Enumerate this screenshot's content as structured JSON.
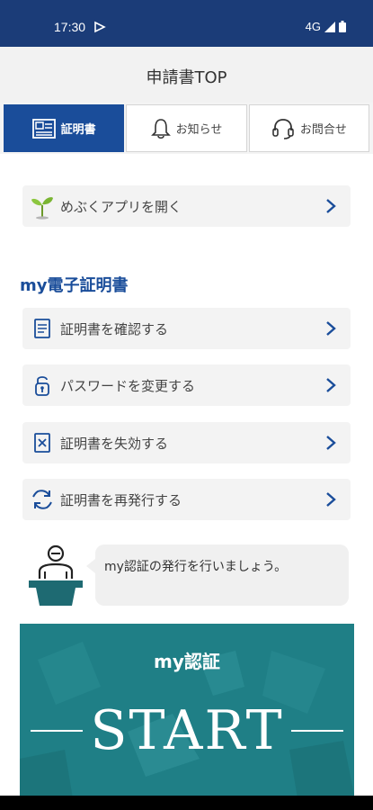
{
  "status": {
    "time": "17:30",
    "network": "4G"
  },
  "header": {
    "title": "申請書TOP"
  },
  "tabs": [
    {
      "label": "証明書",
      "icon": "certificate-icon",
      "active": true
    },
    {
      "label": "お知らせ",
      "icon": "bell-icon",
      "active": false
    },
    {
      "label": "お問合せ",
      "icon": "headset-icon",
      "active": false
    }
  ],
  "open_app": {
    "label": "めぶくアプリを開く",
    "icon": "sprout-icon"
  },
  "section": {
    "title": "my電子証明書"
  },
  "menu": [
    {
      "label": "証明書を確認する",
      "icon": "document-icon"
    },
    {
      "label": "パスワードを変更する",
      "icon": "lock-icon"
    },
    {
      "label": "証明書を失効する",
      "icon": "revoke-document-icon"
    },
    {
      "label": "証明書を再発行する",
      "icon": "refresh-icon"
    }
  ],
  "speech": {
    "text": "my認証の発行を行いましょう。"
  },
  "banner": {
    "title": "my認証",
    "action": "START"
  },
  "colors": {
    "primary": "#1a4d9a",
    "status_bar": "#1b3c78",
    "banner": "#1f7f86"
  }
}
